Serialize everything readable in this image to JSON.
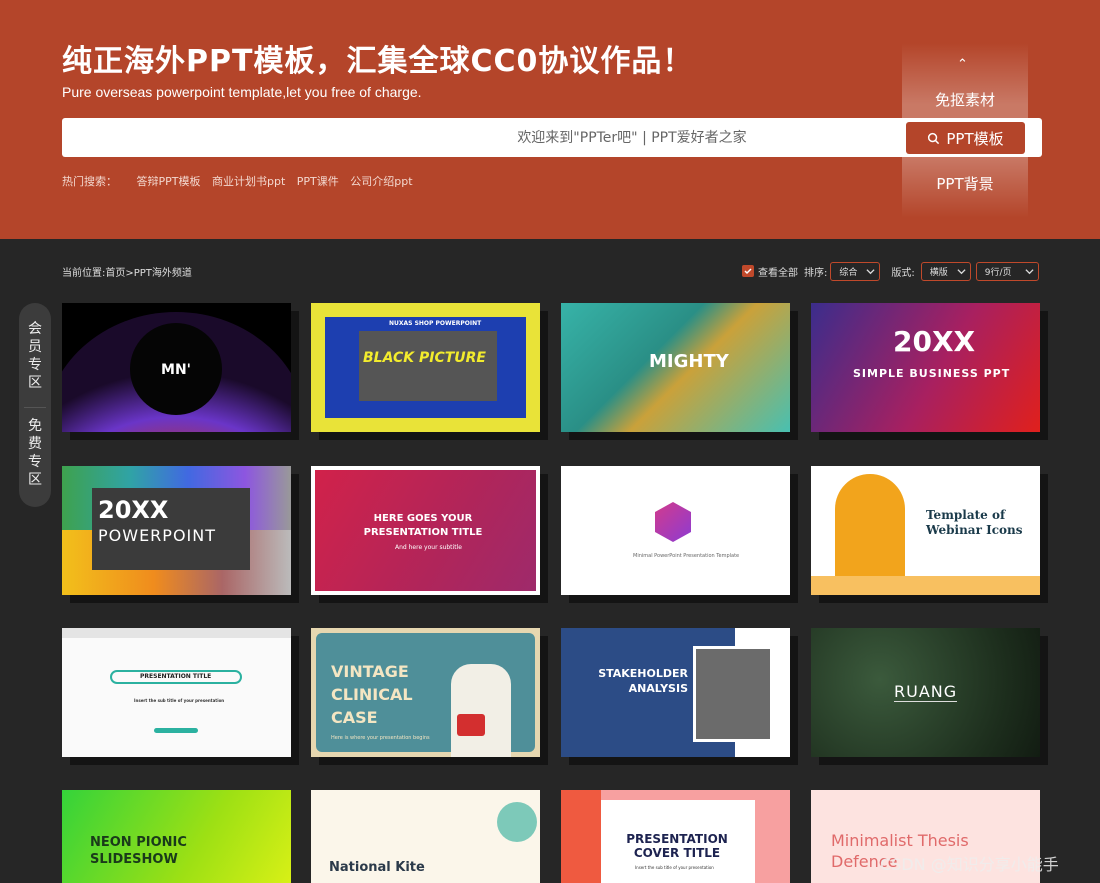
{
  "hero": {
    "title": "纯正海外PPT模板，汇集全球CC0协议作品！",
    "subtitle": "Pure overseas powerpoint template,let you free of charge.",
    "search_placeholder": "欢迎来到\"PPTer吧\" | PPT爱好者之家",
    "search_button": "PPT模板",
    "type_options": [
      "免抠素材",
      "PPT模板",
      "PPT背景"
    ],
    "hot_label": "热门搜索：",
    "hot_links": [
      "答辩PPT模板",
      "商业计划书ppt",
      "PPT课件",
      "公司介绍ppt"
    ]
  },
  "toolbar": {
    "breadcrumb": "当前位置:首页>PPT海外频道",
    "view_all": "查看全部",
    "sort_label": "排序:",
    "sort_value": "综合",
    "format_label": "版式:",
    "format_value": "横版",
    "per_page_value": "9行/页"
  },
  "sidebar": {
    "items": [
      "会员专区",
      "免费专区"
    ]
  },
  "cards": {
    "c2": "BLACK PICTURE",
    "c2_top": "NUXAS SHOP POWERPOINT",
    "c3": "MIGHTY",
    "c4": "20XX",
    "c4_sub": "SIMPLE BUSINESS PPT",
    "c5": "20XX",
    "c5_sub": "POWERPOINT",
    "c6": "HERE GOES YOUR PRESENTATION TITLE",
    "c6_sub": "And here your subtitle",
    "c7_sub": "Minimal PowerPoint Presentation Template",
    "c8": "Template of Webinar Icons",
    "c9": "PRESENTATION TITLE",
    "c9_sub": "Insert the sub title of your presentation",
    "c10": "VINTAGE CLINICAL CASE",
    "c10_sub": "Here is where your presentation begins",
    "c11": "STAKEHOLDER ANALYSIS",
    "c12": "RUANG",
    "c13": "NEON PIONIC SLIDESHOW",
    "c14": "National Kite",
    "c15": "PRESENTATION COVER TITLE",
    "c15_sub": "Insert the sub title of your presentation",
    "c16": "Minimalist Thesis Defence"
  },
  "watermark": "CSDN @知识分享小能手",
  "colors": {
    "brand": "#b4452a",
    "page_bg": "#262626"
  }
}
